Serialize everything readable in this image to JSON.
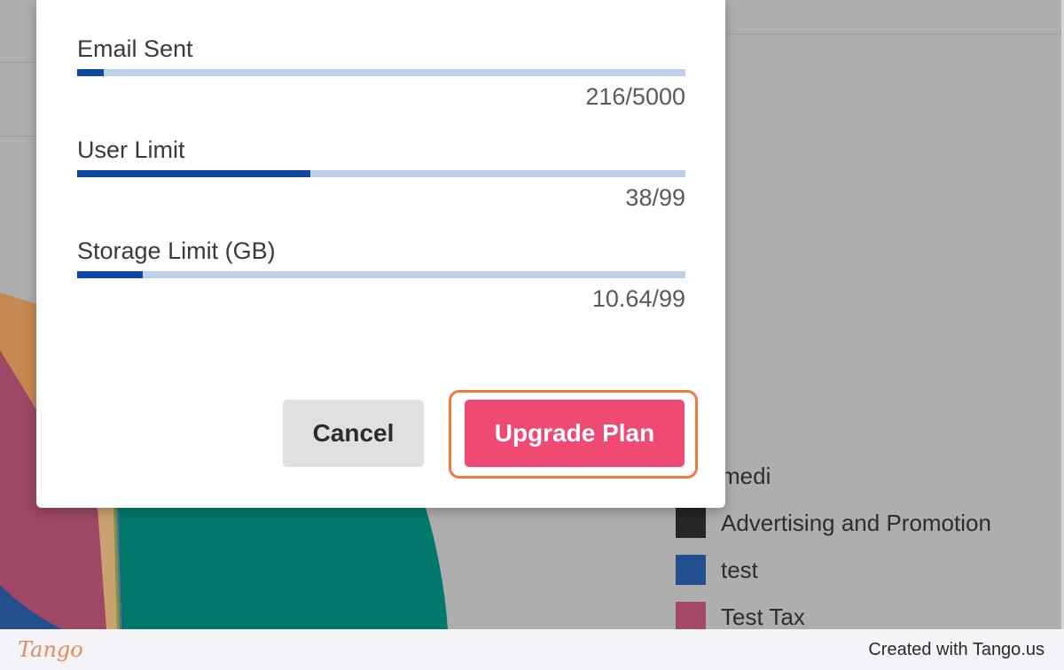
{
  "modal": {
    "usage": [
      {
        "label": "Email Sent",
        "value": "216/5000",
        "fraction": 0.0432
      },
      {
        "label": "User Limit",
        "value": "38/99",
        "fraction": 0.3838
      },
      {
        "label": "Storage Limit (GB)",
        "value": "10.64/99",
        "fraction": 0.1075
      }
    ],
    "cancel_label": "Cancel",
    "upgrade_label": "Upgrade Plan"
  },
  "legend": [
    {
      "label": "medi",
      "color": "#7a7a7a"
    },
    {
      "label": "Advertising and Promotion",
      "color": "#262626"
    },
    {
      "label": "test",
      "color": "#22508f"
    },
    {
      "label": "Test Tax",
      "color": "#a24a68"
    }
  ],
  "footer": {
    "logo": "Tango",
    "credit": "Created with Tango.us"
  },
  "colors": {
    "accent": "#ee4a74",
    "highlight": "#f07a3a",
    "progress_fill": "#0d47a1",
    "progress_track": "#bcd0e8"
  }
}
